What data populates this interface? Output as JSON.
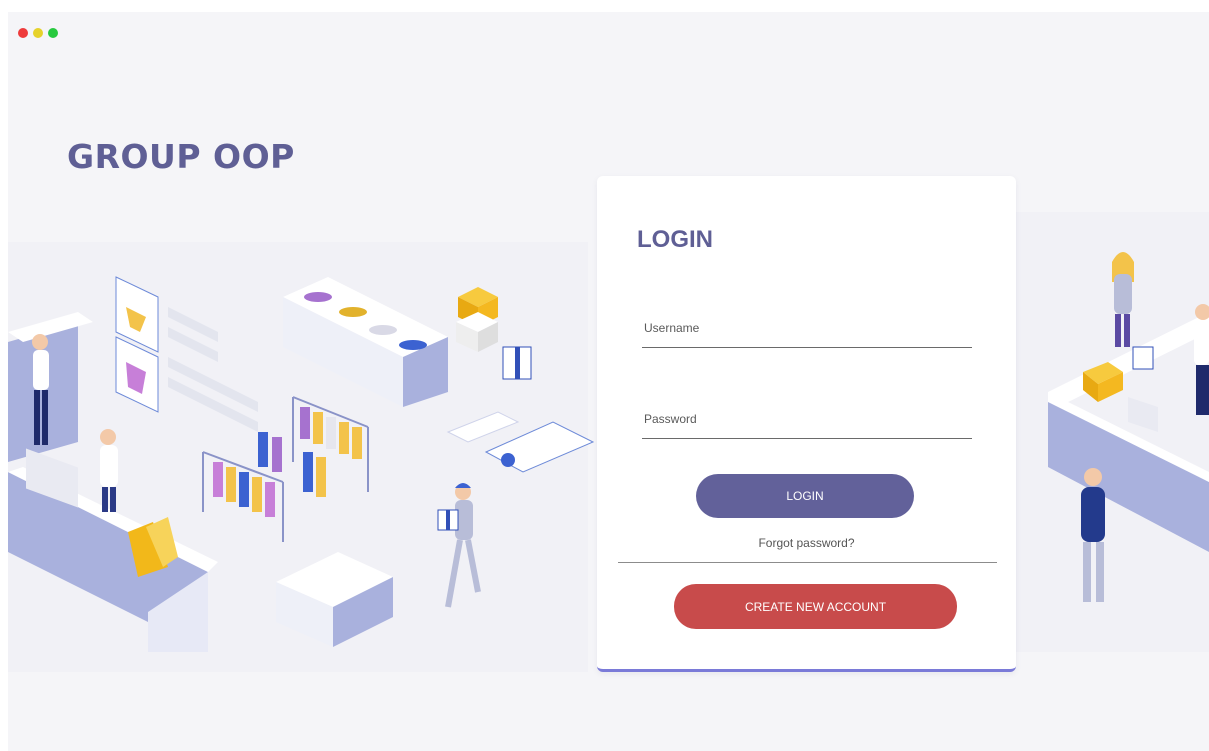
{
  "window": {
    "controls": [
      {
        "name": "close",
        "color": "#ee3b3b"
      },
      {
        "name": "minimize",
        "color": "#e6d22b"
      },
      {
        "name": "maximize",
        "color": "#27c93f"
      }
    ]
  },
  "brand": {
    "title": "GROUP OOP",
    "color": "#5f5f95"
  },
  "login_form": {
    "title": "LOGIN",
    "username_placeholder": "Username",
    "username_value": "",
    "password_placeholder": "Password",
    "password_value": "",
    "login_button": "LOGIN",
    "forgot_link": "Forgot password?",
    "create_button": "CREATE NEW ACCOUNT"
  },
  "colors": {
    "accent": "#62619a",
    "danger": "#c84b4b",
    "background": "#f5f5f8",
    "card_bottom_border": "#7a7ad8"
  }
}
